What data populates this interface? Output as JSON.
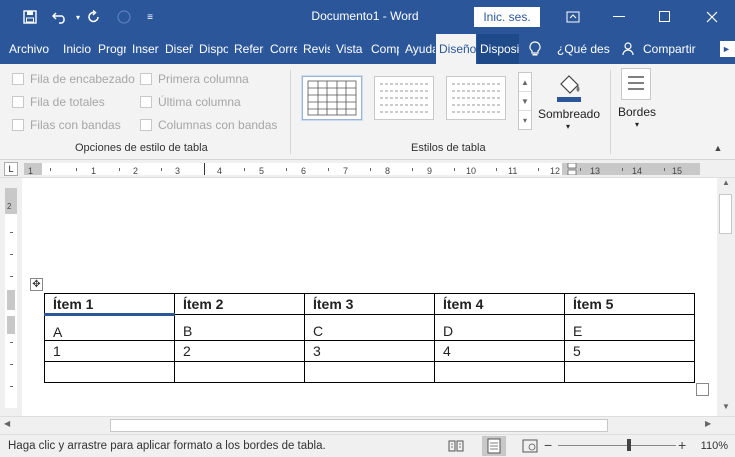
{
  "titlebar": {
    "title": "Documento1 - Word",
    "signin": "Inic. ses.",
    "customize_glyph": "≡"
  },
  "tabs": [
    {
      "label": "Archivo"
    },
    {
      "label": "Inicio"
    },
    {
      "label": "Progra"
    },
    {
      "label": "Insertar"
    },
    {
      "label": "Diseño"
    },
    {
      "label": "Disposición"
    },
    {
      "label": "Referencias"
    },
    {
      "label": "Correspondencia"
    },
    {
      "label": "Revisar"
    },
    {
      "label": "Vista"
    },
    {
      "label": "Complementos"
    },
    {
      "label": "Ayuda"
    },
    {
      "label": "Diseño"
    },
    {
      "label": "Disposición"
    }
  ],
  "tell_me": "¿Qué desea hacer?",
  "share": "Compartir",
  "table_style_options": {
    "group_label": "Opciones de estilo de tabla",
    "items": [
      {
        "label": "Fila de encabezado"
      },
      {
        "label": "Fila de totales"
      },
      {
        "label": "Filas con bandas"
      },
      {
        "label": "Primera columna"
      },
      {
        "label": "Última columna"
      },
      {
        "label": "Columnas con bandas"
      }
    ]
  },
  "table_styles": {
    "group_label": "Estilos de tabla",
    "shading": "Sombreado",
    "borders": "Bordes"
  },
  "ruler": {
    "numbers": [
      "1",
      "2",
      "1",
      "2",
      "3",
      "4",
      "5",
      "6",
      "7",
      "8",
      "9",
      "10",
      "11",
      "12",
      "13",
      "14",
      "15"
    ]
  },
  "table": {
    "header": [
      "Ítem 1",
      "Ítem 2",
      "Ítem 3",
      "Ítem 4",
      "Ítem 5"
    ],
    "rows": [
      [
        "A",
        "B",
        "C",
        "D",
        "E"
      ],
      [
        "1",
        "2",
        "3",
        "4",
        "5"
      ],
      [
        "",
        "",
        "",
        "",
        ""
      ]
    ]
  },
  "status": {
    "message": "Haga clic y arrastre para aplicar formato a los bordes de tabla.",
    "zoom": "110%",
    "zoom_level": 0.6
  }
}
